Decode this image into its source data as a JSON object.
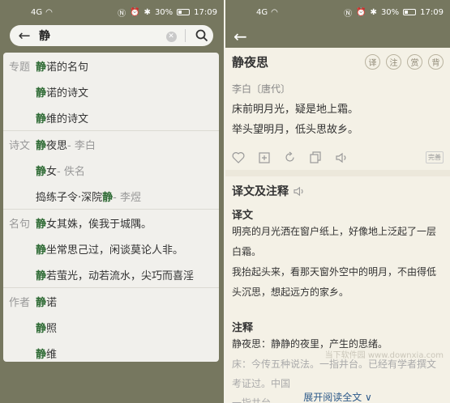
{
  "status": {
    "time": "17:09",
    "battery": "30%",
    "network_left": "4G",
    "network_right": "4G"
  },
  "search": {
    "query": "静"
  },
  "results": [
    {
      "category": "专题",
      "items": [
        {
          "hl": "静",
          "rest": "诺的名句",
          "muted": ""
        },
        {
          "hl": "静",
          "rest": "诺的诗文",
          "muted": ""
        },
        {
          "hl": "静",
          "rest": "维的诗文",
          "muted": ""
        }
      ]
    },
    {
      "category": "诗文",
      "items": [
        {
          "hl": "静",
          "rest": "夜思",
          "muted": " - 李白"
        },
        {
          "hl": "静",
          "rest": "女",
          "muted": " - 佚名"
        },
        {
          "pre": "捣练子令·深院",
          "hl": "静",
          "rest": "",
          "muted": " - 李煜"
        }
      ]
    },
    {
      "category": "名句",
      "items": [
        {
          "hl": "静",
          "rest": "女其姝，俟我于城隅。",
          "muted": ""
        },
        {
          "hl": "静",
          "rest": "坐常思己过，闲谈莫论人非。",
          "muted": ""
        },
        {
          "hl": "静",
          "rest": "若萤光，动若流水，尖巧而喜淫",
          "muted": ""
        }
      ]
    },
    {
      "category": "作者",
      "items": [
        {
          "hl": "静",
          "rest": "诺",
          "muted": ""
        },
        {
          "hl": "静",
          "rest": "照",
          "muted": ""
        },
        {
          "hl": "静",
          "rest": "维",
          "muted": ""
        }
      ]
    }
  ],
  "poem": {
    "title": "静夜思",
    "tools": [
      "译",
      "注",
      "赏",
      "背"
    ],
    "author": "李白〔唐代〕",
    "lines": [
      "床前明月光，疑是地上霜。",
      "举头望明月，低头思故乡。"
    ],
    "tag": "完善"
  },
  "translation": {
    "heading": "译文及注释",
    "sub1": "译文",
    "p1": "明亮的月光洒在窗户纸上，好像地上泛起了一层白霜。",
    "p2": "我抬起头来，看那天窗外空中的明月，不由得低头沉思，想起远方的家乡。",
    "sub2": "注释",
    "n1": "静夜思：静静的夜里，产生的思绪。",
    "n2": "床：今传五种说法。一指井台。已经有学者撰文考证过。中国",
    "n3": "一指井台",
    "more": "展开阅读全文 ∨"
  },
  "watermark": "当下软件园 www.downxia.com"
}
